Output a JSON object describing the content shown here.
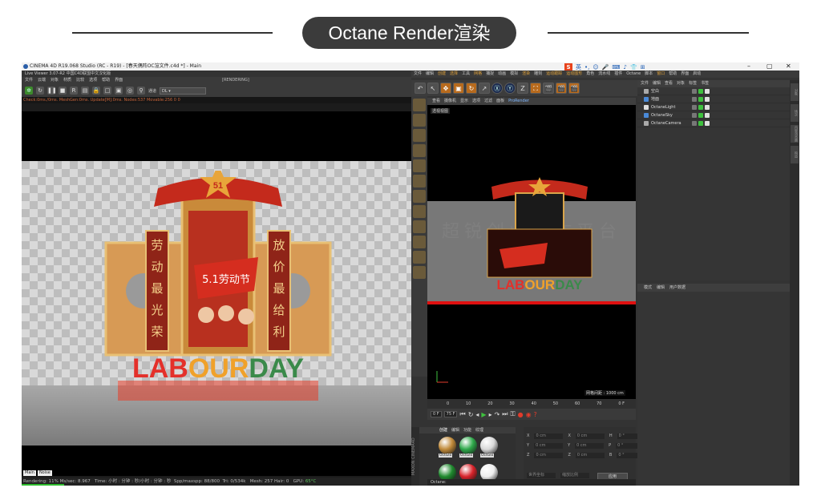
{
  "banner": {
    "title": "Octane Render渲染"
  },
  "window": {
    "title": "CINEMA 4D R19.068 Studio (RC - R19) - [春天偶阵OC渲文件.c4d *] - Main",
    "minimize": "–",
    "maximize": "▢",
    "close": "✕"
  },
  "ime": {
    "items": [
      "S",
      "英",
      "•,",
      "☺",
      "🎤",
      "⌨",
      "♪",
      "👕",
      "⊞"
    ]
  },
  "live_viewer": {
    "title": "Live Viewer 3.07-R2 中国C4D联盟中文汉化版",
    "menu": [
      "文件",
      "云端",
      "对象",
      "材质",
      "比较",
      "选项",
      "帮助",
      "界面"
    ],
    "render_state": "[RENDERING]",
    "dropdown_label": "通道",
    "dropdown_value": "DL",
    "status_line": "Check:0ms./0ms. MeshGen:0ms. Update[M]:0ms. Nodes:537 Movable:256 0 0",
    "tabs": [
      "Main",
      "Noise"
    ],
    "footer": {
      "rendering": "Rendering: 11%",
      "mssec": "Ms/sec: 8.967",
      "time": "Time: 小时 : 分钟 : 秒/小时 : 分钟 : 秒",
      "spp": "Spp/maxspp: 88/800",
      "tri": "Tri: 0/534k",
      "mesh": "Mesh: 257",
      "hair": "Hair: 0",
      "gpu": "GPU: ",
      "temp": "65°C"
    },
    "progress": 0.11
  },
  "scene": {
    "badge_number": "51",
    "banner_text": "5.1劳动节",
    "pillar_left": [
      "劳",
      "动",
      "最",
      "光",
      "荣"
    ],
    "pillar_right": [
      "放",
      "价",
      "最",
      "给",
      "利"
    ],
    "headline_parts": [
      "LAB",
      "OUR",
      "DAY"
    ],
    "headline_colors": [
      "#e4302a",
      "#f0a12a",
      "#3a8a4a"
    ]
  },
  "c4d": {
    "menu": [
      "文件",
      "编辑",
      "创建",
      "选择",
      "工具",
      "网格",
      "捕捉",
      "动画",
      "模拟",
      "渲染",
      "雕刻",
      "运动跟踪",
      "运动图形",
      "角色",
      "流水线",
      "插件",
      "Octane",
      "脚本",
      "窗口",
      "帮助",
      "界面",
      "启动"
    ],
    "highlight_menu": [
      "创建",
      "选择",
      "网格",
      "渲染",
      "运动跟踪",
      "运动图形",
      "窗口"
    ],
    "toolbar": [
      "↶",
      "↖",
      "✥",
      "▣",
      "↻",
      "↗",
      "Ⓧ",
      "Ⓨ",
      "Z",
      "⛶",
      "🎬",
      "🎬",
      "🎬"
    ],
    "viewport_menu": [
      "查看",
      "摄像机",
      "显示",
      "选项",
      "过滤",
      "面板",
      "ProRender"
    ],
    "viewport_label": "透视视图",
    "viewport_scale": "网格间距 : 1000 cm",
    "viewport_watermark": "超锐创业协作平台",
    "timeline_ticks": [
      "0",
      "10",
      "20",
      "30",
      "40",
      "50",
      "60",
      "70"
    ],
    "timeline_end": "0 F",
    "transport": {
      "start": "0 F",
      "end": "75 F"
    },
    "material_menu": [
      "创建",
      "编辑",
      "功能",
      "纹理"
    ],
    "materials": [
      {
        "label": "OctGlo",
        "color": "#c08a3a"
      },
      {
        "label": "OctGlo",
        "color": "#2ea84a"
      },
      {
        "label": "OctGlo",
        "color": "#d8d8d8"
      },
      {
        "label": "",
        "color": "#1f8a2e"
      },
      {
        "label": "",
        "color": "#d8232a"
      },
      {
        "label": "",
        "color": "#eeeeee"
      }
    ],
    "attr_rows": [
      {
        "a": "X",
        "av": "0 cm",
        "b": "X",
        "bv": "0 cm",
        "c": "H",
        "cv": "0 °"
      },
      {
        "a": "Y",
        "av": "0 cm",
        "b": "Y",
        "bv": "0 cm",
        "c": "P",
        "cv": "0 °"
      },
      {
        "a": "Z",
        "av": "0 cm",
        "b": "Z",
        "bv": "0 cm",
        "c": "B",
        "cv": "0 °"
      }
    ],
    "attr_dropdowns": [
      "世界坐标",
      "缩放比例"
    ],
    "apply_label": "应用",
    "object_menu": [
      "文件",
      "编辑",
      "查看",
      "对象",
      "标签",
      "书签"
    ],
    "objects": [
      {
        "name": "空白",
        "color": "#aaaaaa"
      },
      {
        "name": "地面",
        "color": "#4a8ad8"
      },
      {
        "name": "OctaneLight",
        "color": "#dddddd"
      },
      {
        "name": "OctaneSky",
        "color": "#4a8ad8"
      },
      {
        "name": "OctaneCamera",
        "color": "#aaaaaa"
      }
    ],
    "attr_menu": [
      "模式",
      "编辑",
      "用户数据"
    ],
    "right_tabs": [
      "对象",
      "场次",
      "内容浏览器",
      "构造"
    ],
    "status": "Octane:"
  },
  "colors": {
    "accent_red": "#e4302a",
    "gold": "#d9a44a",
    "ui_dark": "#2a2a2a"
  }
}
